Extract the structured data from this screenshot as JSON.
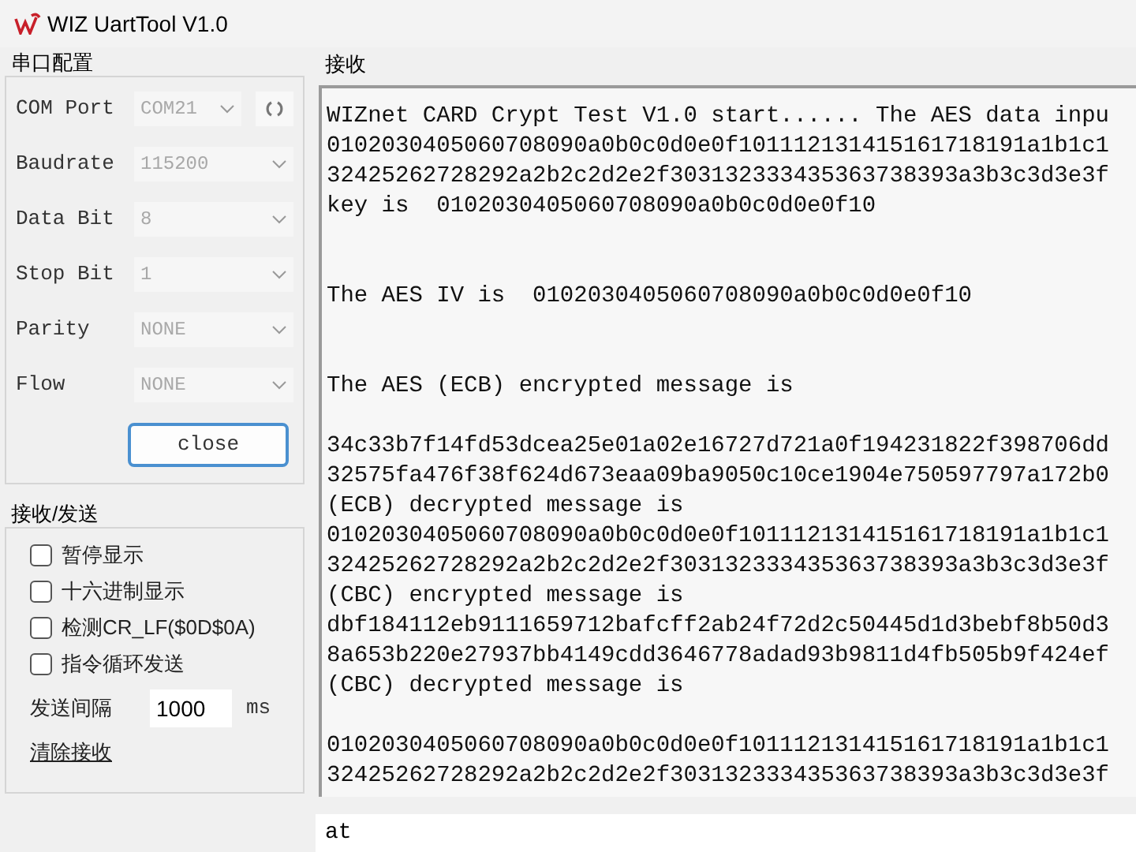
{
  "window": {
    "title": "WIZ UartTool V1.0"
  },
  "serial_config": {
    "title": "串口配置",
    "fields": [
      {
        "label": "COM Port",
        "value": "COM21",
        "disabled": true,
        "refresh": true
      },
      {
        "label": "Baudrate",
        "value": "115200",
        "disabled": true
      },
      {
        "label": "Data Bit",
        "value": "8",
        "disabled": true
      },
      {
        "label": "Stop Bit",
        "value": "1",
        "disabled": true
      },
      {
        "label": "Parity",
        "value": "NONE",
        "disabled": true
      },
      {
        "label": "Flow",
        "value": "NONE",
        "disabled": true
      }
    ],
    "button": "close"
  },
  "rx_tx": {
    "title": "接收/发送",
    "options": [
      {
        "label": "暂停显示",
        "checked": false
      },
      {
        "label": "十六进制显示",
        "checked": false
      },
      {
        "label": "检测CR_LF($0D$0A)",
        "checked": false
      },
      {
        "label": "指令循环发送",
        "checked": false
      }
    ],
    "interval": {
      "label": "发送间隔",
      "value": "1000",
      "unit": "ms"
    },
    "clear_link": "清除接收"
  },
  "receive": {
    "title": "接收",
    "lines": [
      {
        "kind": "text",
        "text": "WIZnet CARD Crypt Test V1.0 start...... The AES data inpu"
      },
      {
        "kind": "text",
        "text": "0102030405060708090a0b0c0d0e0f101112131415161718191a1b1c1"
      },
      {
        "kind": "text",
        "text": "32425262728292a2b2c2d2e2f303132333435363738393a3b3c3d3e3f"
      },
      {
        "kind": "text",
        "text": "key is  0102030405060708090a0b0c0d0e0f10"
      },
      {
        "kind": "blank"
      },
      {
        "kind": "blank"
      },
      {
        "kind": "text",
        "text": "The AES IV is  0102030405060708090a0b0c0d0e0f10"
      },
      {
        "kind": "blank"
      },
      {
        "kind": "blank"
      },
      {
        "kind": "text",
        "text": "The AES (ECB) encrypted message is"
      },
      {
        "kind": "blank"
      },
      {
        "kind": "text",
        "text": "34c33b7f14fd53dcea25e01a02e16727d721a0f194231822f398706dd"
      },
      {
        "kind": "text",
        "text": "32575fa476f38f624d673eaa09ba9050c10ce1904e750597797a172b0"
      },
      {
        "kind": "text",
        "text": "(ECB) decrypted message is"
      },
      {
        "kind": "text",
        "text": "0102030405060708090a0b0c0d0e0f101112131415161718191a1b1c1"
      },
      {
        "kind": "text",
        "text": "32425262728292a2b2c2d2e2f303132333435363738393a3b3c3d3e3f"
      },
      {
        "kind": "text",
        "text": "(CBC) encrypted message is"
      },
      {
        "kind": "text",
        "text": "dbf184112eb9111659712bafcff2ab24f72d2c50445d1d3bebf8b50d3"
      },
      {
        "kind": "text",
        "text": "8a653b220e27937bb4149cdd3646778adad93b9811d4fb505b9f424ef"
      },
      {
        "kind": "text",
        "text": "(CBC) decrypted message is"
      },
      {
        "kind": "blank"
      },
      {
        "kind": "text",
        "text": "0102030405060708090a0b0c0d0e0f101112131415161718191a1b1c1"
      },
      {
        "kind": "text",
        "text": "32425262728292a2b2c2d2e2f303132333435363738393a3b3c3d3e3f"
      }
    ]
  },
  "send_field": {
    "value": "at"
  }
}
